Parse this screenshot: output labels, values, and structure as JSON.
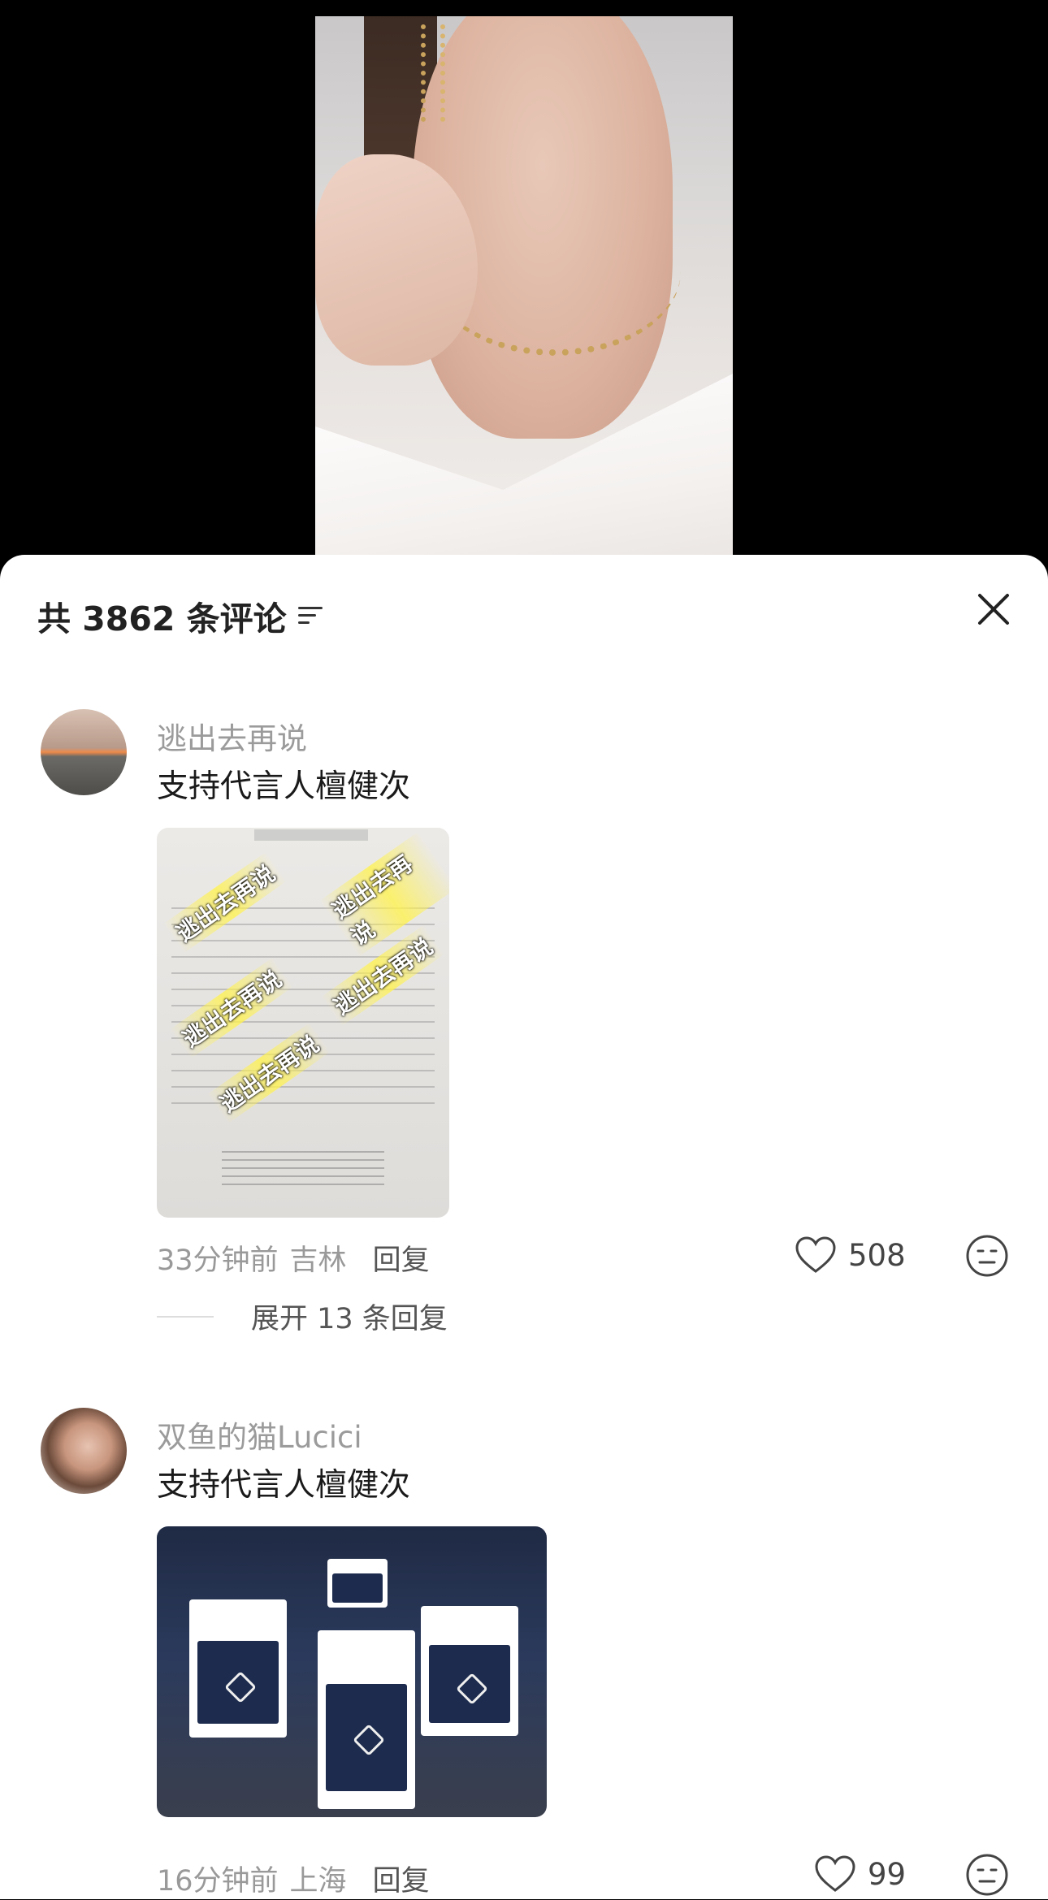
{
  "header": {
    "comment_count": "共 3862 条评论"
  },
  "comments": [
    {
      "author": "逃出去再说",
      "text": "支持代言人檀健次",
      "watermark": "逃出去再说",
      "time": "33分钟前",
      "region": "吉林",
      "reply_label": "回复",
      "likes": "508",
      "expand_label": "展开 13 条回复"
    },
    {
      "author": "双鱼的猫Lucici",
      "text": "支持代言人檀健次",
      "time": "16分钟前",
      "region": "上海",
      "reply_label": "回复",
      "likes": "99"
    }
  ],
  "icons": {
    "filter": "filter-icon",
    "close": "close-icon",
    "like": "heart-icon",
    "emoji": "emoji-icon"
  }
}
